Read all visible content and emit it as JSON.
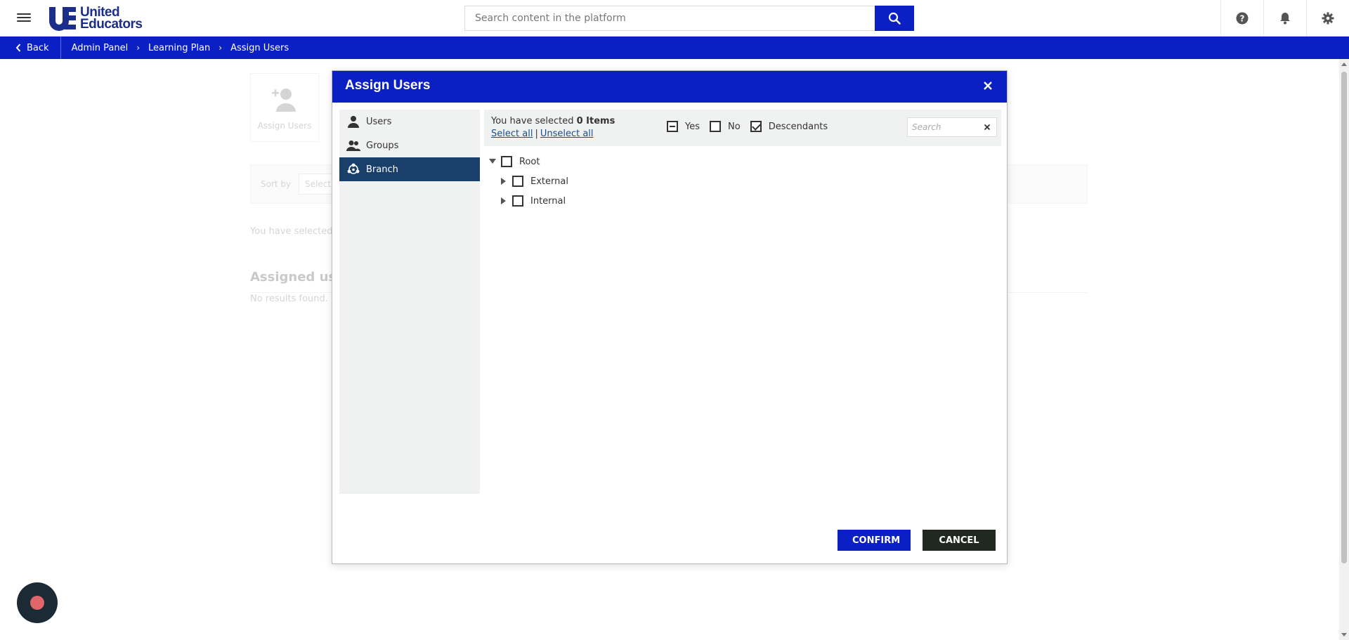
{
  "header": {
    "logo_text_line1": "United",
    "logo_text_line2": "Educators",
    "logo_mark": "UE",
    "search_placeholder": "Search content in the platform",
    "icons": [
      "menu-icon",
      "search-icon",
      "help-icon",
      "bell-icon",
      "gear-icon"
    ]
  },
  "breadcrumb": {
    "back_label": "Back",
    "items": [
      "Admin Panel",
      "Learning Plan",
      "Assign Users"
    ]
  },
  "background_page": {
    "card_label": "Assign Users",
    "sort_label": "Sort by",
    "sort_select": "Select",
    "selected_text": "You have selected",
    "section_title": "Assigned use",
    "empty_text": "No results found."
  },
  "dialog": {
    "title": "Assign Users",
    "sidebar": [
      {
        "label": "Users",
        "icon": "user-icon",
        "active": false
      },
      {
        "label": "Groups",
        "icon": "groups-icon",
        "active": false
      },
      {
        "label": "Branch",
        "icon": "branch-icon",
        "active": true
      }
    ],
    "selection": {
      "prefix": "You have selected",
      "count": "0 Items",
      "select_all": "Select all",
      "separator": "|",
      "unselect_all": "Unselect all"
    },
    "options": [
      {
        "label": "Yes",
        "state": "partial"
      },
      {
        "label": "No",
        "state": "unchecked"
      },
      {
        "label": "Descendants",
        "state": "checked"
      }
    ],
    "search_placeholder": "Search",
    "tree": {
      "root": {
        "label": "Root",
        "expanded": true
      },
      "children": [
        {
          "label": "External",
          "expanded": false
        },
        {
          "label": "Internal",
          "expanded": false
        }
      ]
    },
    "confirm_label": "CONFIRM",
    "cancel_label": "CANCEL"
  },
  "colors": {
    "brand_blue": "#0a1fc4",
    "active_sidebar": "#1b3f6b",
    "cancel_button": "#212821",
    "chat_bubble": "#1c2a36",
    "chat_dot": "#e0666a"
  }
}
